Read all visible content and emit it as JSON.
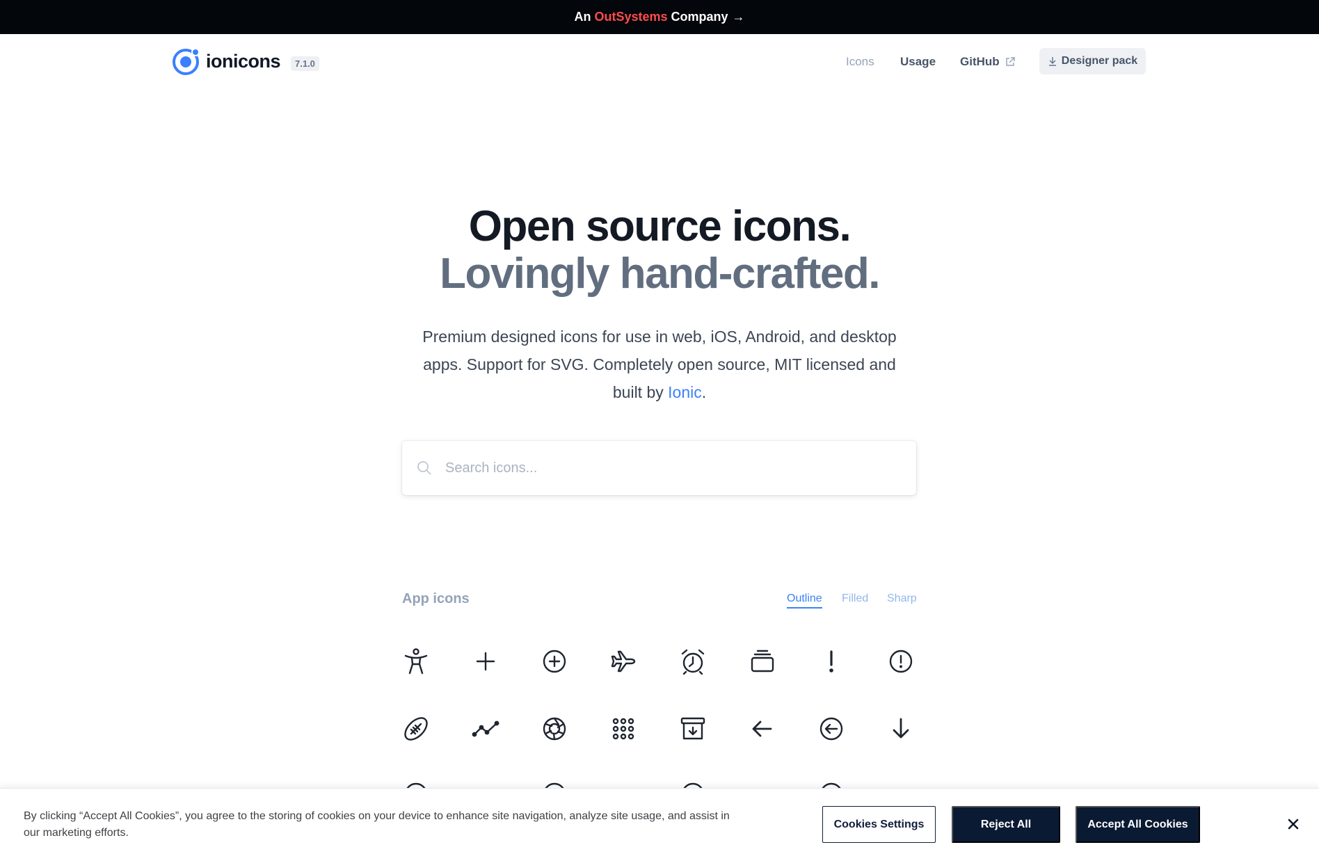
{
  "banner": {
    "prefix": "An",
    "brand": "OutSystems",
    "suffix": "Company",
    "arrow": "→"
  },
  "nav": {
    "logo_text": "ionicons",
    "version": "7.1.0",
    "links": {
      "icons": "Icons",
      "usage": "Usage",
      "github": "GitHub"
    },
    "designer_pack": "Designer pack"
  },
  "hero": {
    "title_line1": "Open source icons.",
    "title_line2": "Lovingly hand-crafted.",
    "desc_before": "Premium designed icons for use in web, iOS, Android, and desktop apps. Support for SVG. Completely open source, MIT licensed and built by ",
    "desc_link": "Ionic",
    "desc_after": "."
  },
  "search": {
    "placeholder": "Search icons..."
  },
  "icons_section": {
    "title": "App icons",
    "tabs": {
      "outline": "Outline",
      "filled": "Filled",
      "sharp": "Sharp"
    },
    "active_tab": "Outline",
    "row1": [
      "accessibility-icon",
      "add-icon",
      "add-circle-icon",
      "airplane-icon",
      "alarm-icon",
      "albums-icon",
      "alert-icon",
      "alert-circle-icon"
    ],
    "row2": [
      "american-football-icon",
      "analytics-icon",
      "aperture-icon",
      "apps-icon",
      "archive-icon",
      "arrow-back-icon",
      "arrow-back-circle-icon",
      "arrow-down-icon"
    ]
  },
  "cookie": {
    "text": "By clicking “Accept All Cookies”, you agree to the storing of cookies on your device to enhance site navigation, analyze site usage, and assist in our marketing efforts.",
    "settings": "Cookies Settings",
    "reject": "Reject All",
    "accept": "Accept All Cookies"
  },
  "colors": {
    "banner_bg": "#03060b",
    "brand_red": "#ff4b4b",
    "accent_blue": "#3b82f6",
    "cookie_button": "#0a1a33"
  }
}
